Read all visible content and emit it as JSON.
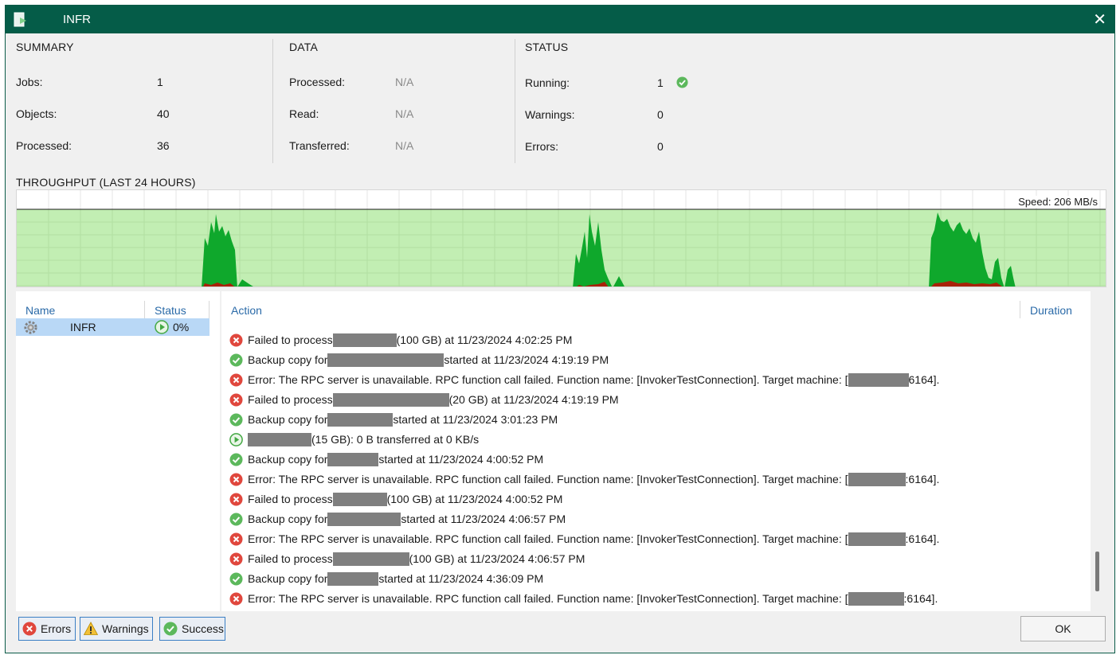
{
  "window": {
    "title": "INFR"
  },
  "summary": {
    "heading": "SUMMARY",
    "items": [
      {
        "label": "Jobs:",
        "value": "1"
      },
      {
        "label": "Objects:",
        "value": "40"
      },
      {
        "label": "Processed:",
        "value": "36"
      }
    ]
  },
  "data": {
    "heading": "DATA",
    "items": [
      {
        "label": "Processed:",
        "value": "N/A"
      },
      {
        "label": "Read:",
        "value": "N/A"
      },
      {
        "label": "Transferred:",
        "value": "N/A"
      }
    ]
  },
  "status": {
    "heading": "STATUS",
    "items": [
      {
        "label": "Running:",
        "value": "1"
      },
      {
        "label": "Warnings:",
        "value": "0"
      },
      {
        "label": "Errors:",
        "value": "0"
      }
    ]
  },
  "throughput": {
    "heading": "THROUGHPUT (LAST 24 HOURS)",
    "speed_label": "Speed: 206 MB/s",
    "colors": {
      "background": "#c2eeb3",
      "read": "#0fa82c",
      "transferred": "#a82208",
      "grid": "#e6e6e6"
    }
  },
  "jobs_panel": {
    "col_name": "Name",
    "col_status": "Status",
    "jobs": [
      {
        "name": "INFR",
        "status": "0%"
      }
    ]
  },
  "actions_panel": {
    "col_action": "Action",
    "col_duration": "Duration",
    "rows": [
      {
        "icon": "error-icon",
        "pre": "Failed to process ",
        "post": "(100 GB) at 11/23/2024 4:02:25 PM"
      },
      {
        "icon": "success-icon",
        "pre": "Backup copy for ",
        "post": "started at 11/23/2024 4:19:19 PM"
      },
      {
        "icon": "error-icon",
        "pre": "Error: The RPC server is unavailable. RPC function call failed. Function name: [InvokerTestConnection]. Target machine: [",
        "post": "6164]."
      },
      {
        "icon": "error-icon",
        "pre": "Failed to process ",
        "post": "(20 GB) at 11/23/2024 4:19:19 PM"
      },
      {
        "icon": "success-icon",
        "pre": "Backup copy for ",
        "post": "started at 11/23/2024 3:01:23 PM"
      },
      {
        "icon": "running-icon",
        "pre": "",
        "post": "(15 GB): 0 B transferred at 0 KB/s"
      },
      {
        "icon": "success-icon",
        "pre": "Backup copy for ",
        "post": "started at 11/23/2024 4:00:52 PM"
      },
      {
        "icon": "error-icon",
        "pre": "Error: The RPC server is unavailable. RPC function call failed. Function name: [InvokerTestConnection]. Target machine: [",
        "post": ":6164]."
      },
      {
        "icon": "error-icon",
        "pre": "Failed to process ",
        "post": "(100 GB) at 11/23/2024 4:00:52 PM"
      },
      {
        "icon": "success-icon",
        "pre": "Backup copy for ",
        "post": "started at 11/23/2024 4:06:57 PM"
      },
      {
        "icon": "error-icon",
        "pre": "Error: The RPC server is unavailable. RPC function call failed. Function name: [InvokerTestConnection]. Target machine: [",
        "post": ":6164]."
      },
      {
        "icon": "error-icon",
        "pre": "Failed to process ",
        "post": "(100 GB) at 11/23/2024 4:06:57 PM"
      },
      {
        "icon": "success-icon",
        "pre": "Backup copy for ",
        "post": "started at 11/23/2024 4:36:09 PM"
      },
      {
        "icon": "error-icon",
        "pre": "Error: The RPC server is unavailable. RPC function call failed. Function name: [InvokerTestConnection]. Target machine: [",
        "post": ":6164]."
      }
    ]
  },
  "footer": {
    "errors_label": "Errors",
    "warnings_label": "Warnings",
    "success_label": "Success",
    "ok_label": "OK"
  }
}
